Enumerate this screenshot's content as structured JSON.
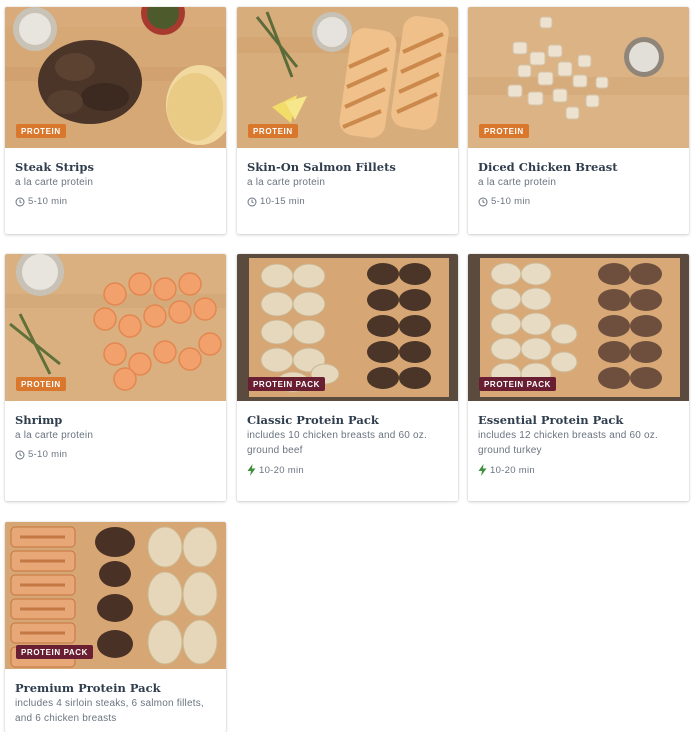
{
  "colors": {
    "protein_badge": "#d9782c",
    "pack_badge": "#6a1e32",
    "title": "#2f3d4c",
    "muted": "#6b7480",
    "bolt": "#3f8f3f"
  },
  "cards": [
    {
      "title": "Steak Strips",
      "subtitle": "a la carte protein",
      "time": "5-10 min",
      "badge": "PROTEIN",
      "icon": "clock-icon"
    },
    {
      "title": "Skin-On Salmon Fillets",
      "subtitle": "a la carte protein",
      "time": "10-15 min",
      "badge": "PROTEIN",
      "icon": "clock-icon"
    },
    {
      "title": "Diced Chicken Breast",
      "subtitle": "a la carte protein",
      "time": "5-10 min",
      "badge": "PROTEIN",
      "icon": "clock-icon"
    },
    {
      "title": "Shrimp",
      "subtitle": "a la carte protein",
      "time": "5-10 min",
      "badge": "PROTEIN",
      "icon": "clock-icon"
    },
    {
      "title": "Classic Protein Pack",
      "subtitle": "includes 10 chicken breasts and 60 oz. ground beef",
      "time": "10-20 min",
      "badge": "PROTEIN PACK",
      "icon": "bolt-icon"
    },
    {
      "title": "Essential Protein Pack",
      "subtitle": "includes 12 chicken breasts and 60 oz. ground turkey",
      "time": "10-20 min",
      "badge": "PROTEIN PACK",
      "icon": "bolt-icon"
    },
    {
      "title": "Premium Protein Pack",
      "subtitle": "includes 4 sirloin steaks, 6 salmon fillets, and 6 chicken breasts",
      "badge": "PROTEIN PACK"
    }
  ]
}
